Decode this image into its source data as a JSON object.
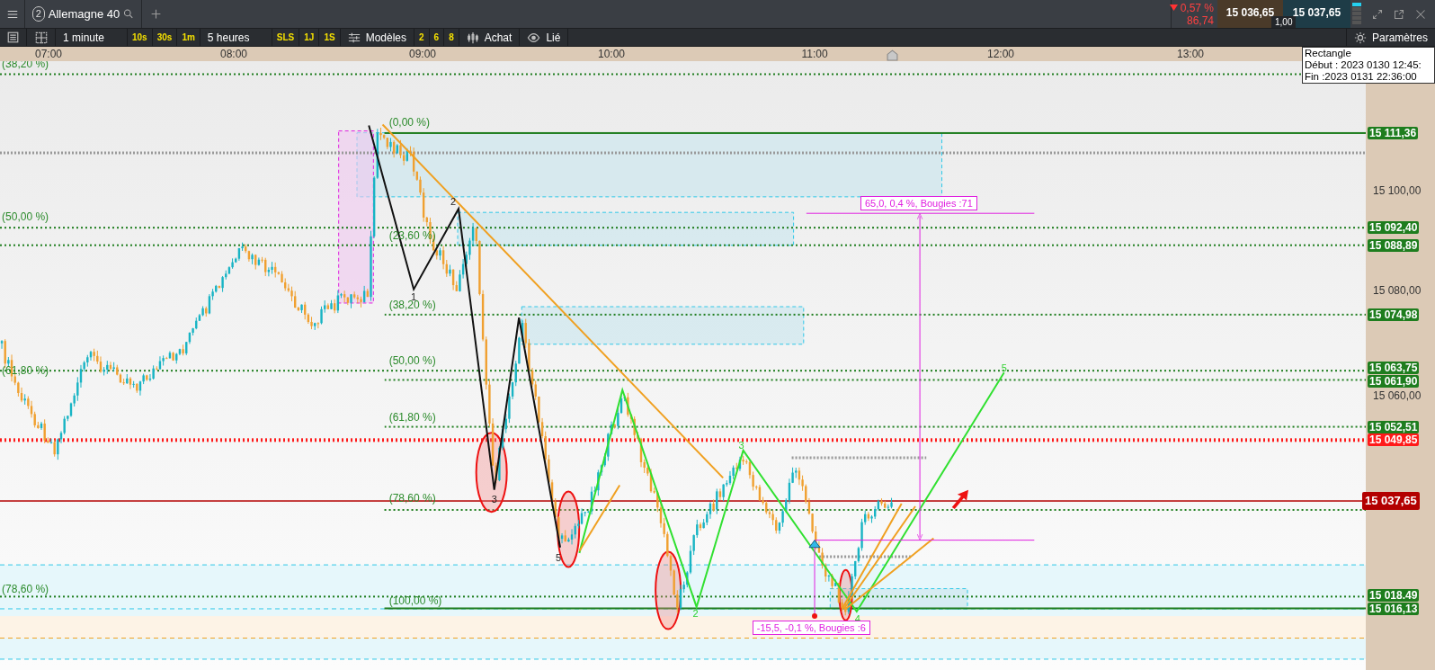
{
  "header": {
    "tab": {
      "number": "2",
      "label": "Allemagne 40",
      "selected": true
    },
    "quote": {
      "down": true,
      "change": "0,57 %",
      "change_points": "86,74",
      "bid": "15 036,65",
      "ask": "15 037,65",
      "spread": "1,00"
    }
  },
  "toolbar": {
    "items": [
      {
        "kind": "dropdown",
        "label": "1 minute"
      },
      {
        "kind": "preset",
        "label": "10s"
      },
      {
        "kind": "preset",
        "label": "30s"
      },
      {
        "kind": "preset",
        "label": "1m"
      },
      {
        "kind": "dropdown",
        "label": "5 heures"
      },
      {
        "kind": "preset",
        "label": "SLS"
      },
      {
        "kind": "preset",
        "label": "1J"
      },
      {
        "kind": "preset",
        "label": "1S"
      },
      {
        "kind": "tool",
        "label": "Modèles"
      },
      {
        "kind": "preset",
        "label": "2"
      },
      {
        "kind": "preset",
        "label": "6"
      },
      {
        "kind": "preset",
        "label": "8"
      },
      {
        "kind": "tool",
        "label": "Achat"
      },
      {
        "kind": "tool",
        "label": "Lié"
      }
    ],
    "settings": "Paramètres"
  },
  "time_axis": [
    "07:00",
    "08:00",
    "09:00",
    "10:00",
    "11:00",
    "12:00",
    "13:00"
  ],
  "tooltip": {
    "title": "Rectangle",
    "lines": [
      "Début : 2023 0130 12:45:",
      "Fin :2023 0131 22:36:00"
    ]
  },
  "price_axis": {
    "ticks": [
      "15 100,00",
      "15 080,00",
      "15 060,00"
    ],
    "levels": [
      {
        "label": "15 111,36",
        "color": "#1e7d1e",
        "dotted": false,
        "current": false
      },
      {
        "label": "15 092,40",
        "color": "#1e7d1e",
        "dotted": true,
        "current": false
      },
      {
        "label": "15 088,89",
        "color": "#1e7d1e",
        "dotted": true,
        "current": false
      },
      {
        "label": "15 074,98",
        "color": "#1e7d1e",
        "dotted": true,
        "current": false
      },
      {
        "label": "15 063,75",
        "color": "#1e7d1e",
        "dotted": true,
        "current": false
      },
      {
        "label": "15 061,90",
        "color": "#1e7d1e",
        "dotted": true,
        "current": false
      },
      {
        "label": "15 052,51",
        "color": "#1e7d1e",
        "dotted": true,
        "current": false
      },
      {
        "label": "15 049,85",
        "color": "#ff1a1a",
        "dotted": true,
        "current": false
      },
      {
        "label": "15 037,65",
        "color": "#b30000",
        "dotted": false,
        "current": true
      },
      {
        "label": "15 018.49",
        "color": "#1e7d1e",
        "dotted": true,
        "current": false
      },
      {
        "label": "15 016,13",
        "color": "#1e7d1e",
        "dotted": false,
        "current": false
      }
    ]
  },
  "fib_left": [
    "(38,20 %)",
    "(50,00 %)",
    "(61,80 %)",
    "(78,60 %)"
  ],
  "fib_right": [
    "(0,00 %)",
    "(23,60 %)",
    "(38,20 %)",
    "(50,00 %)",
    "(61,80 %)",
    "(78,60 %)",
    "(100,00 %)"
  ],
  "waves_black": [
    "1",
    "2",
    "3",
    "5"
  ],
  "waves_green": [
    "2",
    "3",
    "4",
    "5"
  ],
  "measures": [
    "65,0, 0,4 %, Bougies :71",
    "-15,5, -0,1 %, Bougies :6"
  ]
}
